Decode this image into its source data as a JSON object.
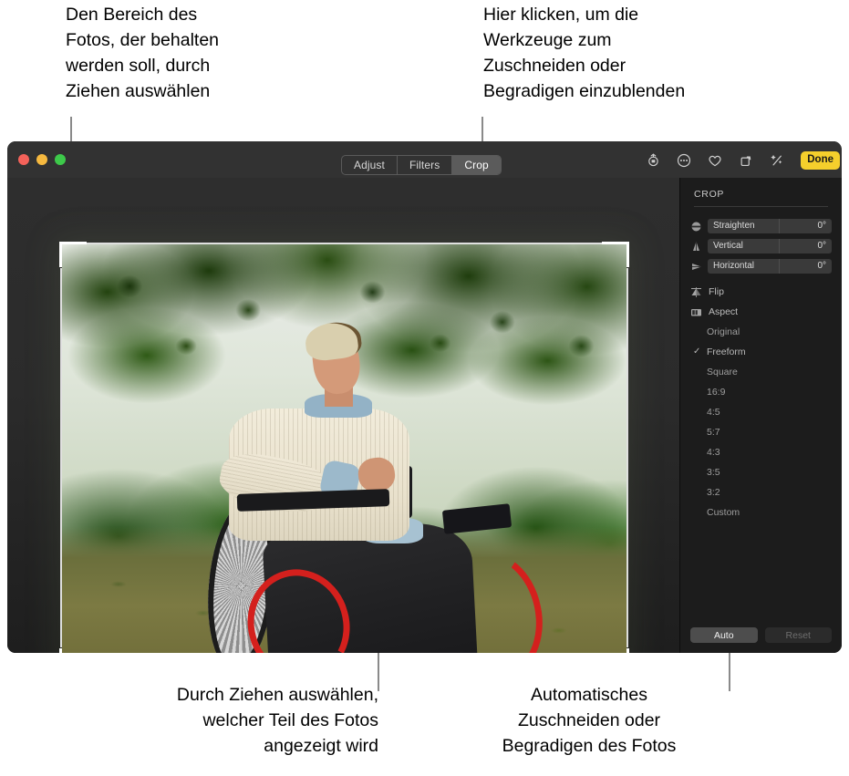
{
  "annotations": {
    "top_left": "Den Bereich des\nFotos, der behalten\nwerden soll, durch\nZiehen auswählen",
    "top_right": "Hier klicken, um die\nWerkzeuge zum\nZuschneiden oder\nBegradigen einzublenden",
    "bottom_left": "Durch Ziehen auswählen,\nwelcher Teil des Fotos\nangezeigt wird",
    "bottom_right": "Automatisches\nZuschneiden oder\nBegradigen des Fotos"
  },
  "window": {
    "traffic_lights": [
      "close",
      "minimize",
      "zoom"
    ]
  },
  "toolbar": {
    "segments": [
      {
        "label": "Adjust",
        "active": false
      },
      {
        "label": "Filters",
        "active": false
      },
      {
        "label": "Crop",
        "active": true
      }
    ],
    "icons": [
      "rotate-counterclockwise-icon",
      "more-options-icon",
      "favorite-heart-icon",
      "rotate-icon",
      "enhance-magic-icon"
    ],
    "done_label": "Done"
  },
  "inspector": {
    "title": "CROP",
    "sliders": [
      {
        "icon": "straighten-icon",
        "label": "Straighten",
        "value": "0°"
      },
      {
        "icon": "vertical-icon",
        "label": "Vertical",
        "value": "0°"
      },
      {
        "icon": "horizontal-icon",
        "label": "Horizontal",
        "value": "0°"
      }
    ],
    "tools": [
      {
        "icon": "flip-icon",
        "label": "Flip"
      },
      {
        "icon": "aspect-icon",
        "label": "Aspect"
      }
    ],
    "aspect_options": [
      {
        "label": "Original",
        "selected": false
      },
      {
        "label": "Freeform",
        "selected": true
      },
      {
        "label": "Square",
        "selected": false
      },
      {
        "label": "16:9",
        "selected": false
      },
      {
        "label": "4:5",
        "selected": false
      },
      {
        "label": "5:7",
        "selected": false
      },
      {
        "label": "4:3",
        "selected": false
      },
      {
        "label": "3:5",
        "selected": false
      },
      {
        "label": "3:2",
        "selected": false
      },
      {
        "label": "Custom",
        "selected": false
      }
    ],
    "checkmark": "✓",
    "auto_label": "Auto",
    "reset_label": "Reset"
  },
  "colors": {
    "accent_done": "#f5cf2c",
    "panel_bg": "#1c1c1c",
    "titlebar_bg": "#323232",
    "canvas_bg": "#2a2a2a",
    "handle": "#ffffff"
  }
}
